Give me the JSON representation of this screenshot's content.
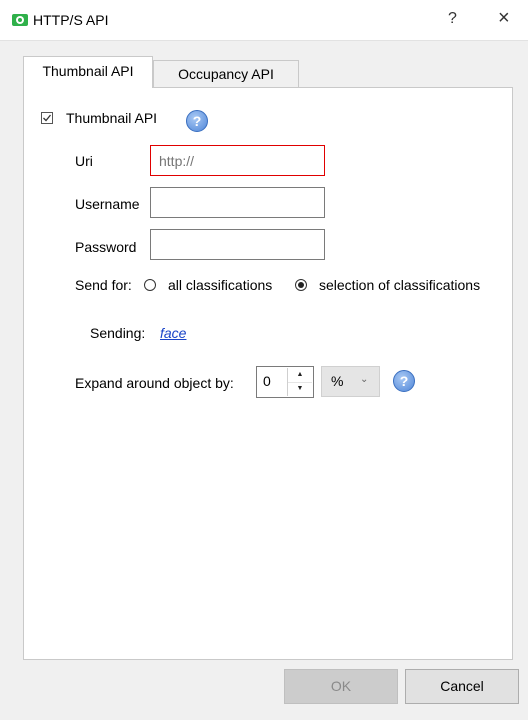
{
  "window": {
    "title": "HTTP/S API",
    "help": "?",
    "close": "×"
  },
  "tabs": [
    {
      "label": "Thumbnail API",
      "active": true
    },
    {
      "label": "Occupancy API",
      "active": false
    }
  ],
  "thumbnail": {
    "checkbox_label": "Thumbnail API",
    "checked": true,
    "help_icon": "info-icon",
    "fields": {
      "uri": {
        "label": "Uri",
        "value": "",
        "placeholder": "http://",
        "invalid": true
      },
      "username": {
        "label": "Username",
        "value": ""
      },
      "password": {
        "label": "Password",
        "value": ""
      }
    },
    "send_for": {
      "label": "Send for:",
      "options": [
        {
          "label": "all classifications",
          "selected": false
        },
        {
          "label": "selection of classifications",
          "selected": true
        }
      ]
    },
    "sending": {
      "label": "Sending:",
      "value": "face"
    },
    "expand": {
      "label": "Expand around object by:",
      "value": "0",
      "unit": "%",
      "up": "▲",
      "down": "▼",
      "dropdown": "⌄"
    }
  },
  "footer": {
    "ok_label": "OK",
    "ok_enabled": false,
    "cancel_label": "Cancel"
  },
  "colors": {
    "accent": "#2fb04a",
    "error_border": "#e00000",
    "link": "#1a44c8"
  }
}
